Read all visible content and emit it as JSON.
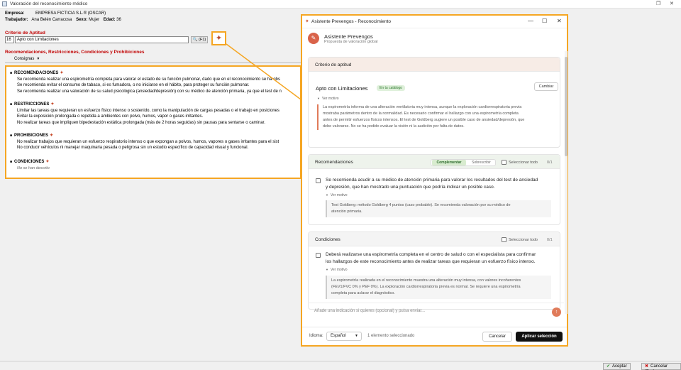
{
  "window": {
    "title": "Valoración del reconocimiento médico"
  },
  "info": {
    "empresa_label": "Empresa:",
    "empresa_value": "EMPRESA FICTICIA S.L.® (OSCAR)",
    "trabajador_label": "Trabajador:",
    "trabajador_value": "Ana Belén Carracosa",
    "sexo_label": "Sexo:",
    "sexo_value": "Mujer",
    "edad_label": "Edad:",
    "edad_value": "36"
  },
  "criterio": {
    "title": "Criterio de Aptitud",
    "code": "16",
    "name": "Apto con Limitaciones",
    "lookup_label": "(F1)"
  },
  "recs_section": {
    "title": "Recomendaciones, Restricciones, Condiciones y Prohibiciones",
    "consignas_label": "Consignas"
  },
  "text_panel": {
    "recomendaciones": {
      "heading": "RECOMENDACIONES",
      "lines": [
        "Se recomienda realizar una espirometría completa para valorar el estado de su función pulmonar, dado que en el reconocimiento se ha obs",
        "Se recomienda evitar el consumo de tabaco, si es fumadora, o no iniciarse en el hábito, para proteger su función pulmonar.",
        "Se recomienda realizar una valoración de su salud psicológica (ansiedad/depresión) con su médico de atención primaria, ya que el test de n"
      ]
    },
    "restricciones": {
      "heading": "RESTRICCIONES",
      "lines": [
        "Limitar las tareas que requieran un esfuerzo físico intenso o sostenido, como la manipulación de cargas pesadas o el trabajo en posiciones",
        "Evitar la exposición prolongada o repetida a ambientes con polvo, humos, vapor o gases irritantes.",
        "No realizar tareas que impliquen bipedestación estática prolongada (más de 2 horas seguidas) sin pausas para sentarse o caminar."
      ]
    },
    "prohibiciones": {
      "heading": "PROHIBICIONES",
      "lines": [
        "No realizar trabajos que requieran un esfuerzo respiratorio intenso o que expongan a polvos, humos, vapores o gases irritantes para el sist",
        "No conducir vehículos ni manejar maquinaria pesada o peligrosa sin un estudio específico de capacidad visual y funcional."
      ]
    },
    "condiciones": {
      "heading": "CONDICIONES",
      "empty": "No se han descrito"
    }
  },
  "bottom": {
    "accept": "Aceptar",
    "cancel": "Cancelar [Esc]"
  },
  "dialog": {
    "title": "Asistente Prevengos - Reconocimiento",
    "assistant_name": "Asistente Prevengos",
    "assistant_sub": "Propuesta de valoración global",
    "criterio_card": {
      "header": "Criterio de aptitud",
      "value": "Apto con Limitaciones",
      "badge": "En tu catálogo",
      "change": "Cambiar",
      "ver_motivo": "Ver motivo",
      "reason": [
        "La espirometría informa de una alteración ventilatoria muy intensa, aunque la exploración cardiorrespiratoria previa",
        "mostraba parámetros dentro de la normalidad. Es necesario confirmar el hallazgo con una espirometría completa",
        "antes de permitir esfuerzos físicos intensos. El test de Goldberg sugiere un posible caso de ansiedad/depresión, que",
        "debe valorarse. No se ha podido evaluar la visión ni la audición por falta de datos."
      ]
    },
    "rec_card": {
      "header": "Recomendaciones",
      "mode_complement": "Complementar",
      "mode_overwrite": "Sobrescribir",
      "select_all": "Seleccionar todo",
      "count": "0/1",
      "item": [
        "Se recomienda acudir a su médico de atención primaria para valorar los resultados del test de ansiedad",
        "y depresión, que han mostrado una puntuación que podría indicar un posible caso."
      ],
      "ver_motivo": "Ver motivo",
      "reason": [
        "Test Goldberg: método Goldberg 4 puntos (caso probable). Se recomienda valoración por su médico de",
        "atención primaria."
      ]
    },
    "cond_card": {
      "header": "Condiciones",
      "select_all": "Seleccionar todo",
      "count": "0/1",
      "item": [
        "Deberá realizarse una espirometría completa en el centro de salud o con el especialista para confirmar",
        "los hallazgos de este reconocimiento antes de realizar tareas que requieran un esfuerzo físico intenso."
      ],
      "ver_motivo": "Ver motivo",
      "reason": [
        "La espirometría realizada en el reconocimiento muestra una alteración muy intensa, con valores incoherentes",
        "(FEV1/FVC 0% y PEF 0%). La exploración cardiorrespiratoria previa es normal. Se requiere una espirometría",
        "completa para aclarar el diagnóstico."
      ]
    },
    "input_placeholder": "Añade una indicación si quieres (opcional) y pulsa enviar...",
    "footer": {
      "language_label": "Idioma:",
      "language_value": "Español",
      "selected_count": "1 elemento seleccionado",
      "cancel": "Cancelar",
      "apply": "Aplicar selección"
    }
  },
  "colors": {
    "highlight": "#f5a623",
    "accent": "#d9634a",
    "section_red": "#c00000"
  }
}
